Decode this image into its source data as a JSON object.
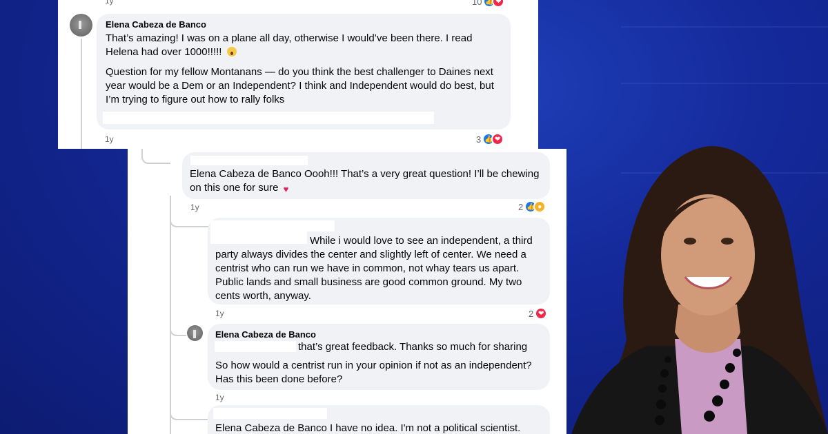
{
  "comments": [
    {
      "author": "Elena Cabeza de Banco",
      "paragraph1": "That’s amazing! I was on a plane all day, otherwise I would’ve been there. I read Helena had over 1000!!!!!",
      "paragraph2": "Question for my fellow Montanans — do you think the best challenger to Daines next year would be a Dem or an Independent? I think and Independent would do best, but I’m trying to figure out how to rally folks",
      "time": "1y",
      "reaction_count": "3",
      "reactions": [
        "like-icon",
        "heart-icon"
      ],
      "inline_emoji": "astonished-face-icon"
    },
    {
      "text": "Elena Cabeza de Banco Oooh!!! That’s a very great question! I’ll be chewing on this one for sure",
      "time": "1y",
      "reaction_count": "2",
      "reactions": [
        "like-icon",
        "care-icon"
      ],
      "inline_emoji": "two-hearts-icon"
    },
    {
      "text": "While i would love to see an independent, a third party always divides the center and slightly left of center. We need a centrist who can run we have in common, not whay tears us apart. Public lands and small business are good common ground. My two cents worth, anyway.",
      "time": "1y",
      "reaction_count": "2",
      "reactions": [
        "heart-icon"
      ]
    },
    {
      "author": "Elena Cabeza de Banco",
      "paragraph1": "that’s great feedback. Thanks so much for sharing",
      "paragraph2": "So how would a centrist run in your opinion if not as an independent? Has this been done before?",
      "time": "1y"
    },
    {
      "text": "Elena Cabeza de Banco I have no idea. I'm not a political scientist."
    }
  ],
  "previous_comment": {
    "time": "1y",
    "reaction_count": "10",
    "reactions": [
      "like-icon",
      "heart-icon"
    ]
  },
  "colors": {
    "background": "#14299a",
    "bubble": "#f0f2f5",
    "like": "#1877f2",
    "heart": "#f02849",
    "meta": "#65676b"
  }
}
